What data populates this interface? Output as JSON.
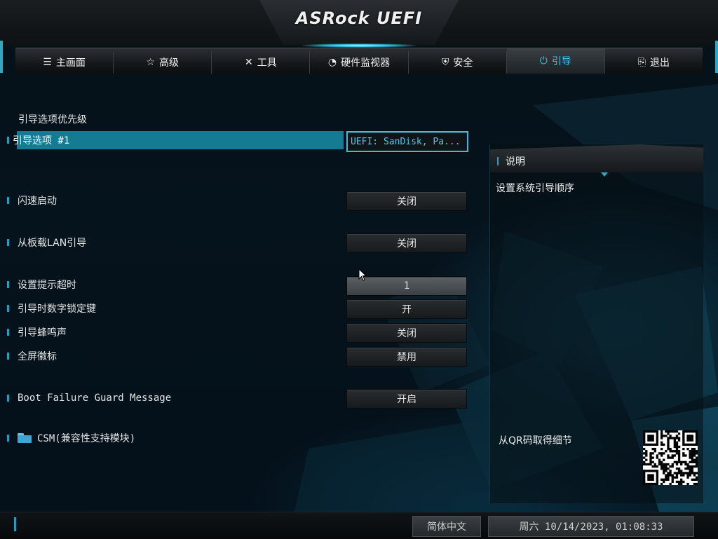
{
  "header": {
    "logo": "ASRock UEFI"
  },
  "tabs": [
    {
      "label": "主画面",
      "icon": "list-icon"
    },
    {
      "label": "高级",
      "icon": "star-icon"
    },
    {
      "label": "工具",
      "icon": "tools-icon"
    },
    {
      "label": "硬件监视器",
      "icon": "monitor-icon"
    },
    {
      "label": "安全",
      "icon": "shield-icon"
    },
    {
      "label": "引导",
      "icon": "power-icon",
      "active": true
    },
    {
      "label": "退出",
      "icon": "exit-icon"
    }
  ],
  "main": {
    "section_title": "引导选项优先级",
    "boot_option_1": {
      "label": "引导选项 #1",
      "value": "UEFI: SanDisk, Pa..."
    },
    "fast_boot": {
      "label": "闪速启动",
      "value": "关闭"
    },
    "onboard_lan_boot": {
      "label": "从板载LAN引导",
      "value": "关闭"
    },
    "setup_prompt_timeout": {
      "label": "设置提示超时",
      "value": "1"
    },
    "bootup_numlock": {
      "label": "引导时数字锁定键",
      "value": "开"
    },
    "boot_beep": {
      "label": "引导蜂鸣声",
      "value": "关闭"
    },
    "full_screen_logo": {
      "label": "全屏徽标",
      "value": "禁用"
    },
    "boot_failure_guard": {
      "label": "Boot Failure Guard Message",
      "value": "开启"
    },
    "csm": {
      "label": "CSM(兼容性支持模块)"
    }
  },
  "description": {
    "title": "说明",
    "text": "设置系统引导顺序",
    "qr_label": "从QR码取得细节"
  },
  "footer": {
    "language": "简体中文",
    "datetime": "周六 10/14/2023, 01:08:33"
  },
  "colors": {
    "accent": "#1fa0be",
    "highlight": "#137c92",
    "active_tab": "#38c8e6"
  }
}
